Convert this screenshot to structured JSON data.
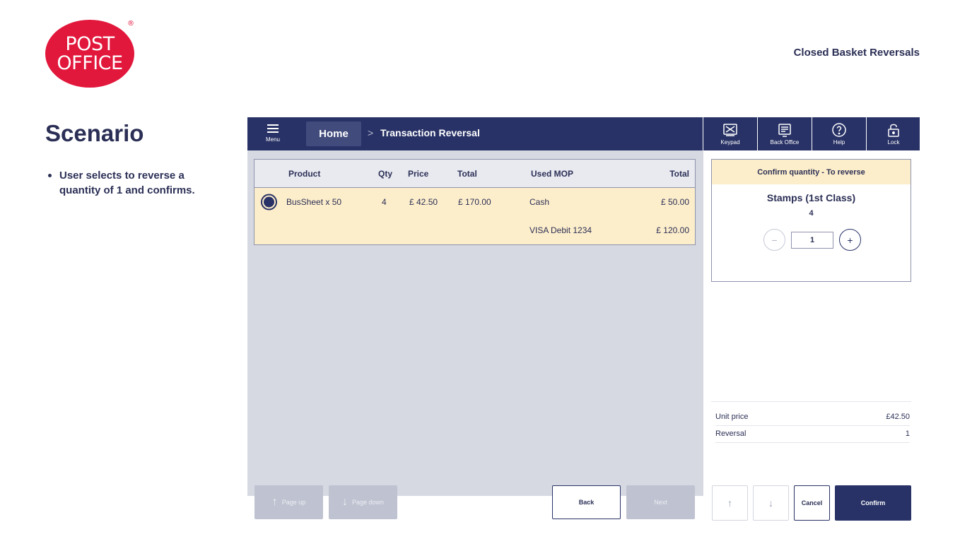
{
  "logo": {
    "line1": "POST",
    "line2": "OFFICE",
    "reg": "®"
  },
  "page_title": "Closed Basket Reversals",
  "scenario": {
    "title": "Scenario",
    "bullets": [
      "User selects to reverse a quantity of 1 and confirms."
    ]
  },
  "topbar": {
    "menu_label": "Menu",
    "home_label": "Home",
    "breadcrumb_sep": ">",
    "current_page": "Transaction Reversal",
    "icons": [
      {
        "label": "Keypad",
        "icon": "keypad-icon"
      },
      {
        "label": "Back Office",
        "icon": "back-office-icon"
      },
      {
        "label": "Help",
        "icon": "help-icon"
      },
      {
        "label": "Lock",
        "icon": "lock-icon"
      }
    ],
    "bg_color": "#283266"
  },
  "table": {
    "headers": {
      "product": "Product",
      "qty": "Qty",
      "price": "Price",
      "total": "Total",
      "used_mop": "Used MOP",
      "mop_total": "Total"
    },
    "rows": [
      {
        "product": "BusSheet x 50",
        "qty": "4",
        "price": "£ 42.50",
        "total": "£ 170.00",
        "mop": "Cash",
        "mop_total": "£ 50.00",
        "selected": true
      },
      {
        "product": "",
        "qty": "",
        "price": "",
        "total": "",
        "mop": "VISA Debit 1234",
        "mop_total": "£ 120.00",
        "selected": false
      }
    ],
    "highlight_color": "#fdeecb"
  },
  "footer_left": {
    "page_up": "Page up",
    "page_down": "Page down",
    "back": "Back",
    "next": "Next"
  },
  "confirm_panel": {
    "header": "Confirm quantity - To reverse",
    "product_name": "Stamps (1st Class)",
    "available_qty": "4",
    "minus": "−",
    "plus": "+",
    "quantity_value": "1"
  },
  "summary": {
    "unit_price_label": "Unit price",
    "unit_price_value": "£42.50",
    "reversal_label": "Reversal",
    "reversal_value": "1"
  },
  "footer_right": {
    "up_arrow": "↑",
    "down_arrow": "↓",
    "cancel": "Cancel",
    "confirm": "Confirm"
  }
}
